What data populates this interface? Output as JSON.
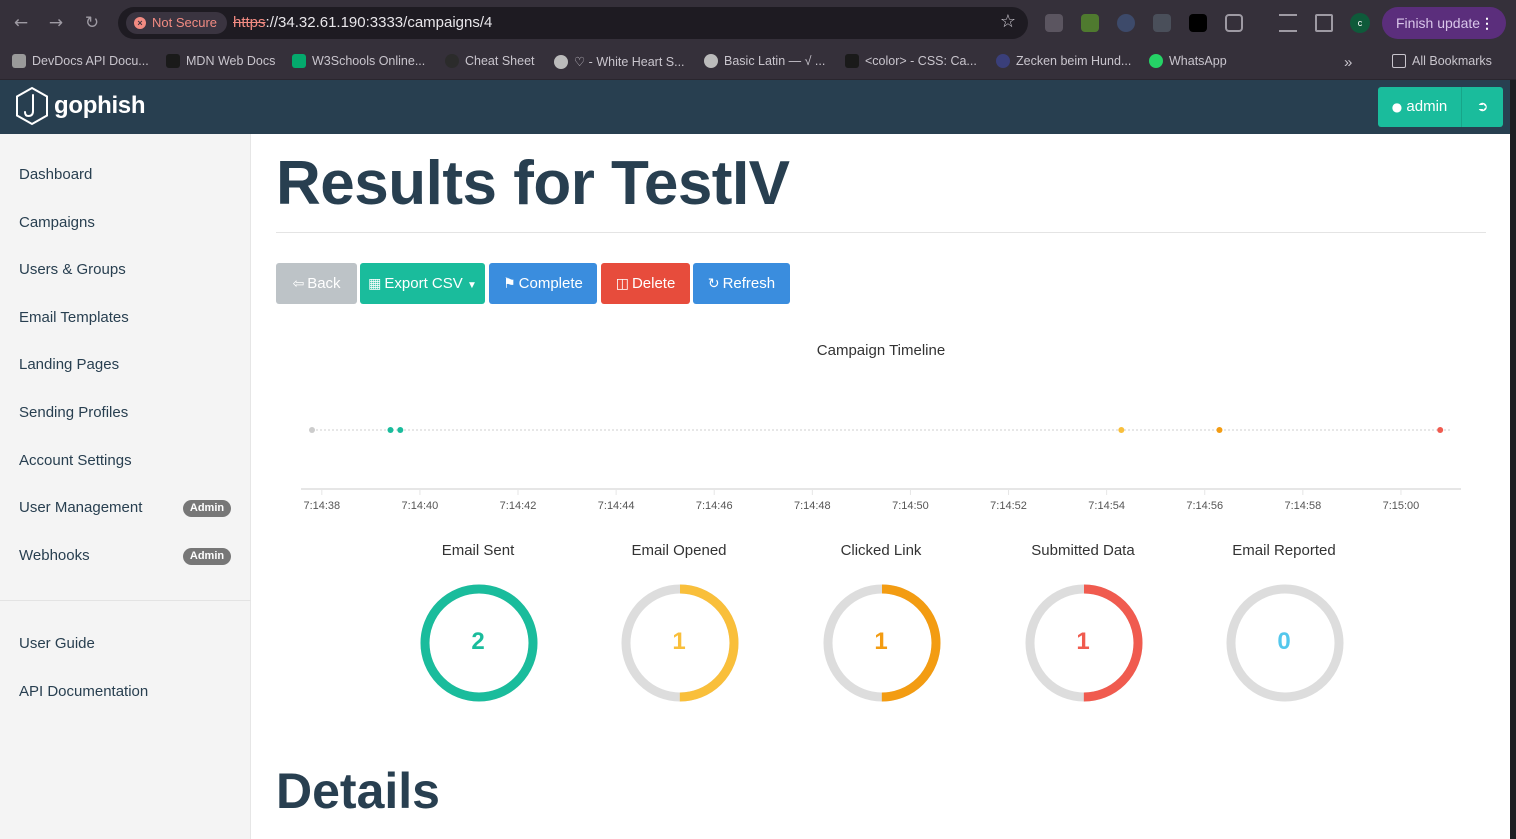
{
  "browser": {
    "security_label": "Not Secure",
    "url_scheme": "https",
    "url_rest": "://34.32.61.190:3333/campaigns/4",
    "profile_initial": "c",
    "finish_update": "Finish update"
  },
  "bookmarks": [
    "DevDocs API Docu...",
    "MDN Web Docs",
    "W3Schools Online...",
    "Cheat Sheet",
    "♡ - White Heart S...",
    "Basic Latin — √ ...",
    "<color> - CSS: Ca...",
    "Zecken beim Hund...",
    "WhatsApp",
    "All Bookmarks"
  ],
  "app": {
    "brand": "gophish",
    "user": "admin",
    "accent": "#1abc9c",
    "navbar_color": "#283f50"
  },
  "sidebar": {
    "items": [
      {
        "label": "Dashboard"
      },
      {
        "label": "Campaigns"
      },
      {
        "label": "Users & Groups"
      },
      {
        "label": "Email Templates"
      },
      {
        "label": "Landing Pages"
      },
      {
        "label": "Sending Profiles"
      },
      {
        "label": "Account Settings"
      },
      {
        "label": "User Management",
        "badge": "Admin"
      },
      {
        "label": "Webhooks",
        "badge": "Admin"
      }
    ],
    "secondary": [
      {
        "label": "User Guide"
      },
      {
        "label": "API Documentation"
      }
    ]
  },
  "main": {
    "title": "Results for TestIV",
    "buttons": {
      "back": "Back",
      "export": "Export CSV",
      "complete": "Complete",
      "delete": "Delete",
      "refresh": "Refresh"
    },
    "timeline_title": "Campaign Timeline",
    "details_heading": "Details"
  },
  "chart_data": [
    {
      "type": "scatter",
      "title": "Campaign Timeline",
      "x_ticks": [
        "7:14:38",
        "7:14:40",
        "7:14:42",
        "7:14:44",
        "7:14:46",
        "7:14:48",
        "7:14:50",
        "7:14:52",
        "7:14:54",
        "7:14:56",
        "7:14:58",
        "7:15:00"
      ],
      "x_range": [
        "7:14:37.8",
        "7:15:01"
      ],
      "points": [
        {
          "x": "7:14:37.8",
          "color": "#cccccc"
        },
        {
          "x": "7:14:39.4",
          "color": "#1abc9c"
        },
        {
          "x": "7:14:39.6",
          "color": "#1abc9c"
        },
        {
          "x": "7:14:54.3",
          "color": "#f9bf3b"
        },
        {
          "x": "7:14:56.3",
          "color": "#f39c12"
        },
        {
          "x": "7:15:00.8",
          "color": "#f05b4f"
        }
      ]
    },
    {
      "type": "pie",
      "stats": [
        {
          "label": "Email Sent",
          "value": 2,
          "total": 2,
          "color": "#1abc9c"
        },
        {
          "label": "Email Opened",
          "value": 1,
          "total": 2,
          "color": "#f9bf3b"
        },
        {
          "label": "Clicked Link",
          "value": 1,
          "total": 2,
          "color": "#f39c12"
        },
        {
          "label": "Submitted Data",
          "value": 1,
          "total": 2,
          "color": "#f05b4f"
        },
        {
          "label": "Email Reported",
          "value": 0,
          "total": 2,
          "color": "#54c7ec"
        }
      ]
    }
  ]
}
